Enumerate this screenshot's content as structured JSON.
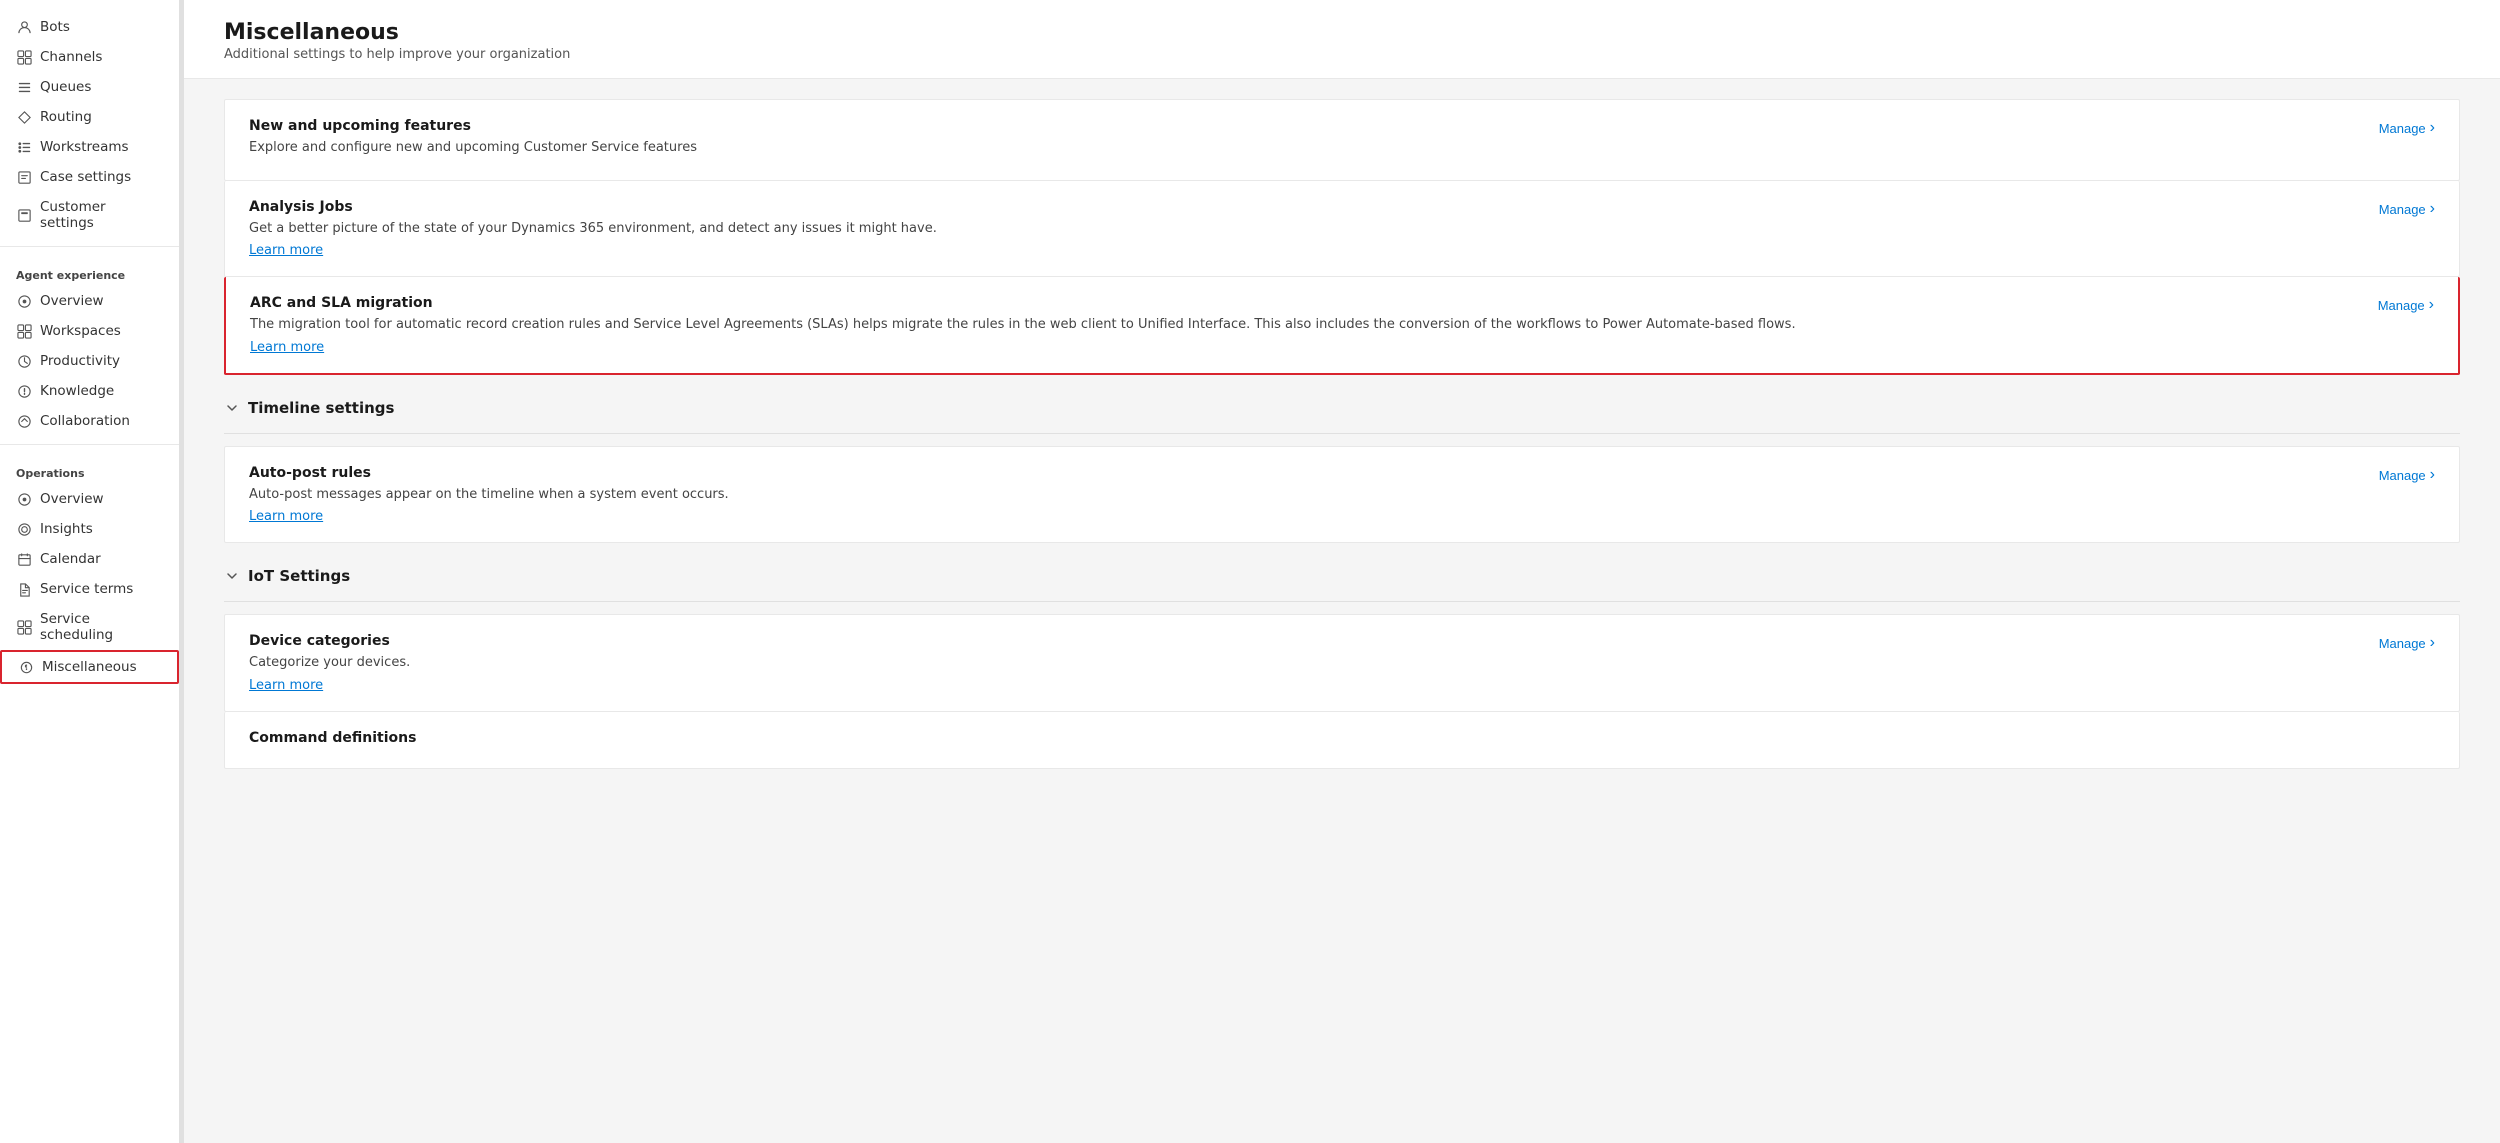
{
  "sidebar": {
    "items_top": [
      {
        "id": "bots",
        "label": "Bots",
        "icon": "👤"
      },
      {
        "id": "channels",
        "label": "Channels",
        "icon": "⊞"
      },
      {
        "id": "queues",
        "label": "Queues",
        "icon": "☰"
      },
      {
        "id": "routing",
        "label": "Routing",
        "icon": "◇"
      },
      {
        "id": "workstreams",
        "label": "Workstreams",
        "icon": "⋯"
      },
      {
        "id": "case-settings",
        "label": "Case settings",
        "icon": "☐"
      },
      {
        "id": "customer-settings",
        "label": "Customer settings",
        "icon": "⊟"
      }
    ],
    "agent_experience_label": "Agent experience",
    "agent_experience_items": [
      {
        "id": "overview-ae",
        "label": "Overview",
        "icon": "⊙"
      },
      {
        "id": "workspaces",
        "label": "Workspaces",
        "icon": "⊞"
      },
      {
        "id": "productivity",
        "label": "Productivity",
        "icon": "⊕"
      },
      {
        "id": "knowledge",
        "label": "Knowledge",
        "icon": "⊗"
      },
      {
        "id": "collaboration",
        "label": "Collaboration",
        "icon": "⊘"
      }
    ],
    "operations_label": "Operations",
    "operations_items": [
      {
        "id": "overview-ops",
        "label": "Overview",
        "icon": "⊙"
      },
      {
        "id": "insights",
        "label": "Insights",
        "icon": "◎"
      },
      {
        "id": "calendar",
        "label": "Calendar",
        "icon": "⊟"
      },
      {
        "id": "service-terms",
        "label": "Service terms",
        "icon": "◈"
      },
      {
        "id": "service-scheduling",
        "label": "Service scheduling",
        "icon": "⊞"
      },
      {
        "id": "miscellaneous",
        "label": "Miscellaneous",
        "icon": "⚙"
      }
    ]
  },
  "page": {
    "title": "Miscellaneous",
    "subtitle": "Additional settings to help improve your organization"
  },
  "sections": [
    {
      "id": "features",
      "expanded": true,
      "cards": [
        {
          "id": "new-features",
          "title": "New and upcoming features",
          "desc": "Explore and configure new and upcoming Customer Service features",
          "link": null,
          "manage_label": "Manage"
        },
        {
          "id": "analysis-jobs",
          "title": "Analysis Jobs",
          "desc": "Get a better picture of the state of your Dynamics 365 environment, and detect any issues it might have.",
          "link": "Learn more",
          "manage_label": "Manage",
          "highlighted": false
        },
        {
          "id": "arc-sla-migration",
          "title": "ARC and SLA migration",
          "desc": "The migration tool for automatic record creation rules and Service Level Agreements (SLAs) helps migrate the rules in the web client to Unified Interface. This also includes the conversion of the workflows to Power Automate-based flows.",
          "link": "Learn more",
          "manage_label": "Manage",
          "highlighted": true
        }
      ]
    },
    {
      "id": "timeline-settings",
      "label": "Timeline settings",
      "expanded": true,
      "cards": [
        {
          "id": "auto-post-rules",
          "title": "Auto-post rules",
          "desc": "Auto-post messages appear on the timeline when a system event occurs.",
          "link": "Learn more",
          "manage_label": "Manage"
        }
      ]
    },
    {
      "id": "iot-settings",
      "label": "IoT Settings",
      "expanded": true,
      "cards": [
        {
          "id": "device-categories",
          "title": "Device categories",
          "desc": "Categorize your devices.",
          "link": "Learn more",
          "manage_label": "Manage"
        },
        {
          "id": "command-definitions",
          "title": "Command definitions",
          "desc": null,
          "link": null,
          "manage_label": null
        }
      ]
    }
  ],
  "icons": {
    "chevron_down": "›",
    "chevron_right": "›"
  }
}
